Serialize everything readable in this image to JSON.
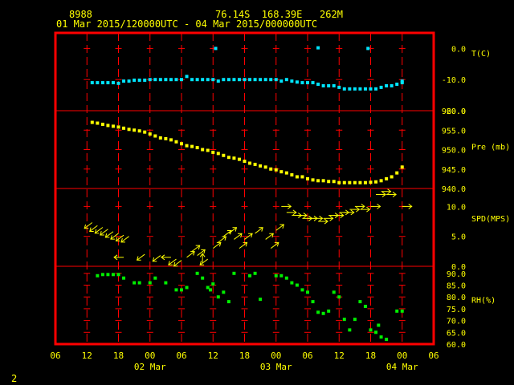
{
  "header": {
    "station": "8988",
    "coords": "76.14S  168.39E   262M",
    "period": "01 Mar 2015/120000UTC - 04 Mar 2015/000000UTC"
  },
  "footer": {
    "frame_number": "2"
  },
  "colors": {
    "text": "#ffff00",
    "frame": "#ff0000",
    "grid": "#ff0000",
    "temperature": "#00e5ff",
    "pressure": "#ffff00",
    "wind": "#ffff00",
    "humidity": "#00ee00"
  },
  "chart_data": {
    "type": "scatter",
    "x_unit": "hours since 01 Mar 00UTC",
    "x_ticks": [
      {
        "x": 6,
        "label": "06"
      },
      {
        "x": 12,
        "label": "12"
      },
      {
        "x": 18,
        "label": "18"
      },
      {
        "x": 24,
        "label": "00"
      },
      {
        "x": 30,
        "label": "06"
      },
      {
        "x": 36,
        "label": "12"
      },
      {
        "x": 42,
        "label": "18"
      },
      {
        "x": 48,
        "label": "00"
      },
      {
        "x": 54,
        "label": "06"
      },
      {
        "x": 60,
        "label": "12"
      },
      {
        "x": 66,
        "label": "18"
      },
      {
        "x": 72,
        "label": "00"
      },
      {
        "x": 78,
        "label": "06"
      }
    ],
    "x_day_labels": [
      {
        "x": 24,
        "label": "02 Mar"
      },
      {
        "x": 48,
        "label": "03 Mar"
      },
      {
        "x": 72,
        "label": "04 Mar"
      }
    ],
    "xlim": [
      6,
      78
    ],
    "panels": [
      {
        "name": "T(C)",
        "ylim": [
          -20,
          5
        ],
        "yticks": [
          "0.0",
          "-10.0",
          "-20.0"
        ],
        "ytick_values": [
          0,
          -10,
          -20
        ],
        "series": [
          {
            "style": "square",
            "x": [
              13,
              14,
              15,
              16,
              17,
              18,
              19,
              20,
              21,
              22,
              23,
              24,
              25,
              26,
              27,
              28,
              29,
              30,
              31,
              32,
              33,
              34,
              35,
              36,
              37,
              38,
              39,
              40,
              41,
              42,
              43,
              44,
              45,
              46,
              47,
              48,
              49,
              50,
              51,
              52,
              53,
              54,
              55,
              56,
              57,
              58,
              59,
              60,
              61,
              62,
              63,
              64,
              65,
              66,
              67,
              68,
              69,
              70,
              71,
              72,
              72,
              36.5,
              56,
              65.5
            ],
            "y": [
              -11,
              -11,
              -11,
              -11,
              -11,
              -11.2,
              -10.5,
              -10.5,
              -10.2,
              -10.2,
              -10.2,
              -10,
              -10,
              -10,
              -10,
              -10,
              -10,
              -10,
              -9,
              -10,
              -10,
              -10,
              -10,
              -10,
              -10.5,
              -10,
              -10,
              -10,
              -10,
              -10,
              -10,
              -10,
              -10,
              -10,
              -10,
              -10,
              -10.5,
              -10,
              -10.5,
              -10.8,
              -11,
              -11,
              -11,
              -11.5,
              -12,
              -12,
              -12,
              -12.5,
              -13,
              -13,
              -13,
              -13,
              -13,
              -13,
              -13,
              -12.5,
              -12,
              -12,
              -11.5,
              -11,
              -10.5,
              0.0,
              0.2,
              0.0
            ]
          }
        ]
      },
      {
        "name": "Pre (mb)",
        "ylim": [
          940,
          960
        ],
        "yticks": [
          "960.0",
          "955.0",
          "950.0",
          "945.0",
          "940.0"
        ],
        "ytick_values": [
          960,
          955,
          950,
          945,
          940
        ],
        "series": [
          {
            "style": "square",
            "x": [
              13,
              14,
              15,
              16,
              17,
              18,
              19,
              20,
              21,
              22,
              23,
              24,
              25,
              26,
              27,
              28,
              29,
              30,
              31,
              32,
              33,
              34,
              35,
              36,
              37,
              38,
              39,
              40,
              41,
              42,
              43,
              44,
              45,
              46,
              47,
              48,
              49,
              50,
              51,
              52,
              53,
              54,
              55,
              56,
              57,
              58,
              59,
              60,
              61,
              62,
              63,
              64,
              65,
              66,
              67,
              68,
              69,
              70,
              71,
              72
            ],
            "y": [
              957,
              956.8,
              956.5,
              956.2,
              956,
              955.8,
              955.5,
              955.2,
              955,
              954.8,
              954.5,
              954,
              953.5,
              953,
              952.8,
              952.5,
              952,
              951.5,
              951,
              950.8,
              950.5,
              950,
              949.8,
              949.3,
              949,
              948.5,
              948,
              947.8,
              947.5,
              947,
              946.5,
              946.2,
              945.8,
              945.5,
              945,
              944.8,
              944.3,
              944,
              943.5,
              943,
              943,
              942.5,
              942.2,
              942,
              942,
              941.8,
              941.8,
              941.5,
              941.5,
              941.5,
              941.5,
              941.5,
              941.5,
              941.6,
              941.7,
              942,
              942.5,
              943,
              944,
              945.5
            ]
          }
        ]
      },
      {
        "name": "SPD(MPS)",
        "ylim": [
          0,
          13
        ],
        "yticks": [
          "10.0",
          "5.0",
          "0.0"
        ],
        "ytick_values": [
          10,
          5,
          0
        ],
        "barbs": [
          {
            "x": 13,
            "speed": 7.3,
            "dir": "sw"
          },
          {
            "x": 14,
            "speed": 6.8,
            "dir": "sw"
          },
          {
            "x": 15,
            "speed": 6.5,
            "dir": "sw"
          },
          {
            "x": 16,
            "speed": 6.2,
            "dir": "sw"
          },
          {
            "x": 17,
            "speed": 5.8,
            "dir": "sw"
          },
          {
            "x": 18,
            "speed": 5.5,
            "dir": "sw"
          },
          {
            "x": 19,
            "speed": 5.2,
            "dir": "sw"
          },
          {
            "x": 20,
            "speed": 5.0,
            "dir": "sw"
          },
          {
            "x": 19,
            "speed": 1.5,
            "dir": "w"
          },
          {
            "x": 23,
            "speed": 2.0,
            "dir": "sw"
          },
          {
            "x": 26,
            "speed": 1.8,
            "dir": "sw"
          },
          {
            "x": 28,
            "speed": 1.5,
            "dir": "w"
          },
          {
            "x": 29,
            "speed": 1.2,
            "dir": "sw"
          },
          {
            "x": 30,
            "speed": 1.0,
            "dir": "sw"
          },
          {
            "x": 31,
            "speed": 1.5,
            "dir": "ne"
          },
          {
            "x": 32,
            "speed": 2.5,
            "dir": "ne"
          },
          {
            "x": 33,
            "speed": 1.8,
            "dir": "ne"
          },
          {
            "x": 34,
            "speed": 0.5,
            "dir": "n"
          },
          {
            "x": 35,
            "speed": 1.2,
            "dir": "sw"
          },
          {
            "x": 36,
            "speed": 3.0,
            "dir": "ne"
          },
          {
            "x": 37,
            "speed": 4.0,
            "dir": "ne"
          },
          {
            "x": 38,
            "speed": 5.0,
            "dir": "ne"
          },
          {
            "x": 39,
            "speed": 5.5,
            "dir": "ne"
          },
          {
            "x": 40,
            "speed": 4.5,
            "dir": "ne"
          },
          {
            "x": 41,
            "speed": 3.0,
            "dir": "ne"
          },
          {
            "x": 42,
            "speed": 4.5,
            "dir": "ne"
          },
          {
            "x": 44,
            "speed": 5.5,
            "dir": "ne"
          },
          {
            "x": 46,
            "speed": 4.5,
            "dir": "ne"
          },
          {
            "x": 47,
            "speed": 3.0,
            "dir": "ne"
          },
          {
            "x": 48,
            "speed": 6.0,
            "dir": "ne"
          },
          {
            "x": 49,
            "speed": 10.0,
            "dir": "e"
          },
          {
            "x": 50,
            "speed": 9.0,
            "dir": "e"
          },
          {
            "x": 51,
            "speed": 8.5,
            "dir": "e"
          },
          {
            "x": 52,
            "speed": 8.5,
            "dir": "e"
          },
          {
            "x": 53,
            "speed": 8.0,
            "dir": "e"
          },
          {
            "x": 54,
            "speed": 8.0,
            "dir": "e"
          },
          {
            "x": 55,
            "speed": 8.0,
            "dir": "e"
          },
          {
            "x": 56,
            "speed": 7.5,
            "dir": "e"
          },
          {
            "x": 57,
            "speed": 8.0,
            "dir": "e"
          },
          {
            "x": 58,
            "speed": 8.5,
            "dir": "e"
          },
          {
            "x": 59,
            "speed": 8.5,
            "dir": "e"
          },
          {
            "x": 60,
            "speed": 9.0,
            "dir": "e"
          },
          {
            "x": 61,
            "speed": 9.0,
            "dir": "e"
          },
          {
            "x": 62,
            "speed": 9.5,
            "dir": "e"
          },
          {
            "x": 63,
            "speed": 10.0,
            "dir": "e"
          },
          {
            "x": 64,
            "speed": 9.5,
            "dir": "e"
          },
          {
            "x": 66,
            "speed": 10.0,
            "dir": "e"
          },
          {
            "x": 67,
            "speed": 12.0,
            "dir": "e"
          },
          {
            "x": 68,
            "speed": 12.5,
            "dir": "e"
          },
          {
            "x": 69,
            "speed": 12.0,
            "dir": "e"
          },
          {
            "x": 72,
            "speed": 10.0,
            "dir": "e"
          }
        ]
      },
      {
        "name": "RH(%)",
        "ylim": [
          60,
          93
        ],
        "yticks": [
          "90.0",
          "85.0",
          "80.0",
          "75.0",
          "70.0",
          "65.0",
          "60.0"
        ],
        "ytick_values": [
          90,
          85,
          80,
          75,
          70,
          65,
          60
        ],
        "series": [
          {
            "style": "square",
            "x": [
              14,
              15,
              16,
              17,
              18,
              19,
              21,
              22,
              24,
              25,
              27,
              29,
              30,
              31,
              33,
              34,
              35,
              35.5,
              36,
              37,
              38,
              39,
              40,
              43,
              44,
              45,
              48,
              49,
              50,
              51,
              52,
              53,
              54,
              55,
              56,
              57,
              58,
              59,
              60,
              61,
              62,
              63,
              64,
              65,
              66,
              67,
              67.5,
              68,
              69,
              71,
              72
            ],
            "y": [
              89,
              89.5,
              89.5,
              89.5,
              89.5,
              88,
              86,
              86,
              86,
              88,
              86,
              83,
              83,
              84,
              90,
              88,
              84,
              83,
              85.5,
              80,
              82,
              78,
              90,
              89,
              90,
              79,
              89,
              89,
              88,
              86,
              85,
              83,
              82,
              78,
              73.5,
              73,
              74,
              82,
              80,
              70.5,
              66,
              70.5,
              78,
              76,
              66,
              65,
              68,
              63,
              62,
              74,
              74
            ]
          }
        ]
      }
    ]
  }
}
